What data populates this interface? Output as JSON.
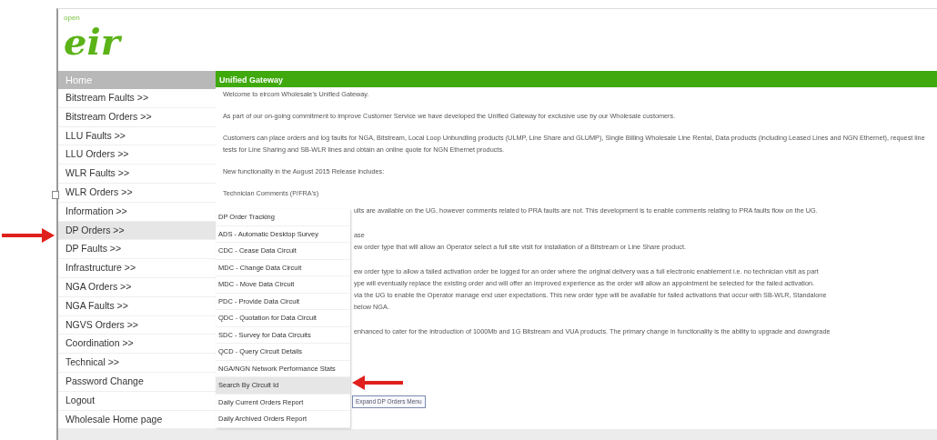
{
  "logo": {
    "small_text": "open",
    "wordmark": "eir"
  },
  "sidebar": {
    "header": "Home",
    "items": [
      {
        "label": "Bitstream Faults >>",
        "selected": false
      },
      {
        "label": "Bitstream Orders >>",
        "selected": false
      },
      {
        "label": "LLU Faults >>",
        "selected": false
      },
      {
        "label": "LLU Orders >>",
        "selected": false
      },
      {
        "label": "WLR Faults >>",
        "selected": false
      },
      {
        "label": "WLR Orders >>",
        "selected": false
      },
      {
        "label": "Information >>",
        "selected": false
      },
      {
        "label": "DP Orders >>",
        "selected": true
      },
      {
        "label": "DP Faults >>",
        "selected": false
      },
      {
        "label": "Infrastructure >>",
        "selected": false
      },
      {
        "label": "NGA Orders >>",
        "selected": false
      },
      {
        "label": "NGA Faults >>",
        "selected": false
      },
      {
        "label": "NGVS Orders >>",
        "selected": false
      },
      {
        "label": "Coordination >>",
        "selected": false
      },
      {
        "label": "Technical >>",
        "selected": false
      },
      {
        "label": "Password Change",
        "selected": false
      },
      {
        "label": "Logout",
        "selected": false
      },
      {
        "label": "Wholesale Home page",
        "selected": false
      }
    ]
  },
  "content": {
    "title": "Unified Gateway",
    "paragraphs": [
      "Welcome to eircom Wholesale's Unified Gateway.",
      "As part of our on-going commitment to improve Customer Service we have developed the Unified Gateway for exclusive use by our Wholesale customers.",
      "Customers can place orders and log faults for NGA, Bitstream, Local Loop Unbundling products (ULMP, Line Share and GLUMP), Single Billing Wholesale Line Rental, Data products (including Leased Lines and NGN Ethernet), request line tests for Line Sharing and SB-WLR lines and obtain an online quote for NGN Ethernet products.",
      "New functionality in the August 2015 Release includes:",
      "Technician Comments (P/FRA's)"
    ],
    "partial_paragraphs": [
      [
        "ults are available on the UG, however comments related to PRA faults are not. This development is to enable comments relating to PRA faults flow on the UG."
      ],
      [
        "ase",
        "ew order type that will allow an Operator select a full site visit for installation of a Bitstream or Line Share product."
      ],
      [
        "ew order type to allow a failed activation order be logged for an order where the original delivery was a full electronic enablement i.e. no technician visit as part",
        "ype will eventually replace the existing order and will offer an improved experience as the order will allow an appointment be selected for the failed activation.",
        "via the UG to enable the Operator manage end user expectations. This new order type will be available for failed activations that occur with SB-WLR, Standalone",
        "below NGA."
      ],
      [
        "enhanced to cater for the introduction of 1000Mb and 1G Bitstream and VUA products. The primary change in functionality is the ability to upgrade and downgrade"
      ]
    ]
  },
  "flyout_menu": {
    "items": [
      {
        "label": "DP Order Tracking",
        "selected": false
      },
      {
        "label": "ADS - Automatic Desktop Survey",
        "selected": false
      },
      {
        "label": "CDC - Cease Data Circuit",
        "selected": false
      },
      {
        "label": "MDC - Change Data Circuit",
        "selected": false
      },
      {
        "label": "MDC - Move Data Circuit",
        "selected": false
      },
      {
        "label": "PDC - Provide Data Circuit",
        "selected": false
      },
      {
        "label": "QDC - Quotation for Data Circuit",
        "selected": false
      },
      {
        "label": "SDC - Survey for Data Circuits",
        "selected": false
      },
      {
        "label": "QCD - Query Circuit Details",
        "selected": false
      },
      {
        "label": "NGA/NGN Network Performance Stats",
        "selected": false
      },
      {
        "label": "Search By Circuit Id",
        "selected": true
      },
      {
        "label": "Daily Current Orders Report",
        "selected": false
      },
      {
        "label": "Daily Archived Orders Report",
        "selected": false
      }
    ]
  },
  "tooltip": "Expand DP Orders Menu"
}
